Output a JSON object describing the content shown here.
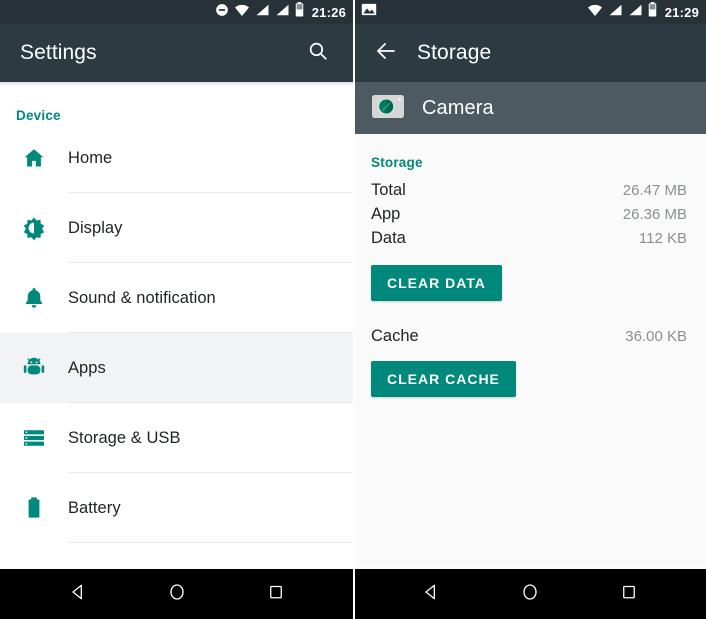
{
  "left_screen": {
    "statusbar": {
      "icons": [
        "do-not-disturb-icon",
        "wifi-icon",
        "signal-icon",
        "signal-icon",
        "battery-icon"
      ],
      "time": "21:26"
    },
    "toolbar": {
      "title": "Settings",
      "search_icon": "search-icon"
    },
    "section_header": "Device",
    "items": [
      {
        "label": "Home",
        "icon": "home-icon",
        "selected": false
      },
      {
        "label": "Display",
        "icon": "brightness-icon",
        "selected": false
      },
      {
        "label": "Sound & notification",
        "icon": "bell-icon",
        "selected": false
      },
      {
        "label": "Apps",
        "icon": "android-icon",
        "selected": true
      },
      {
        "label": "Storage & USB",
        "icon": "storage-icon",
        "selected": false
      },
      {
        "label": "Battery",
        "icon": "battery-full-icon",
        "selected": false
      }
    ],
    "navbar": {
      "back": "back-triangle-icon",
      "home": "home-circle-icon",
      "recents": "recents-square-icon"
    }
  },
  "right_screen": {
    "statusbar": {
      "notification_icon": "screenshot-image-icon",
      "icons": [
        "wifi-icon",
        "signal-icon",
        "signal-icon",
        "battery-icon"
      ],
      "time": "21:29"
    },
    "toolbar": {
      "back_icon": "arrow-back-icon",
      "title": "Storage"
    },
    "app_band": {
      "app_icon": "camera-app-icon",
      "app_name": "Camera"
    },
    "storage": {
      "section_title": "Storage",
      "rows": [
        {
          "key": "Total",
          "value": "26.47 MB"
        },
        {
          "key": "App",
          "value": "26.36 MB"
        },
        {
          "key": "Data",
          "value": "112 KB"
        }
      ],
      "clear_data_button": "CLEAR DATA",
      "cache_row": {
        "key": "Cache",
        "value": "36.00 KB"
      },
      "clear_cache_button": "CLEAR CACHE"
    },
    "navbar": {
      "back": "back-triangle-icon",
      "home": "home-circle-icon",
      "recents": "recents-square-icon"
    }
  },
  "colors": {
    "accent_teal": "#00897b",
    "status_bar": "#263238",
    "toolbar": "#2c3a42",
    "app_band": "#4d5a61",
    "selected_row": "#f2f3f4"
  }
}
